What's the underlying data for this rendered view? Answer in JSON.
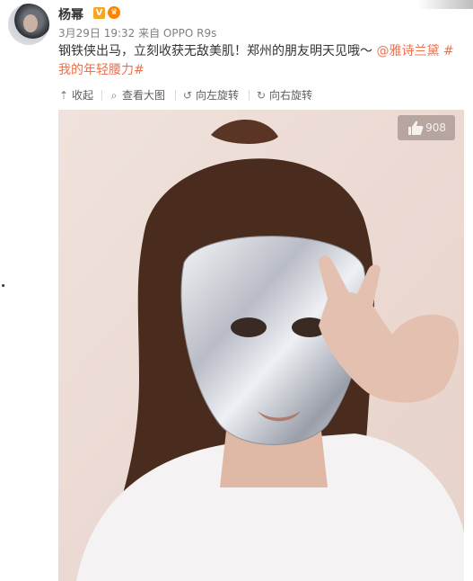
{
  "post": {
    "username": "杨幂",
    "verified_badge": "V",
    "vip_icon": "crown-icon",
    "meta": "3月29日 19:32 来自 OPPO R9s",
    "text_main": "钢铁侠出马，立刻收获无敌美肌！郑州的朋友明天见哦～ ",
    "mention": "@雅诗兰黛",
    "hashtag": " #我的年轻腰力#",
    "link_color": "#eb7350"
  },
  "toolbar": {
    "collapse": "收起",
    "view_large": "查看大图",
    "rotate_left": "向左旋转",
    "rotate_right": "向右旋转"
  },
  "image": {
    "like_count": "908",
    "like_icon": "thumbs-up-icon"
  }
}
